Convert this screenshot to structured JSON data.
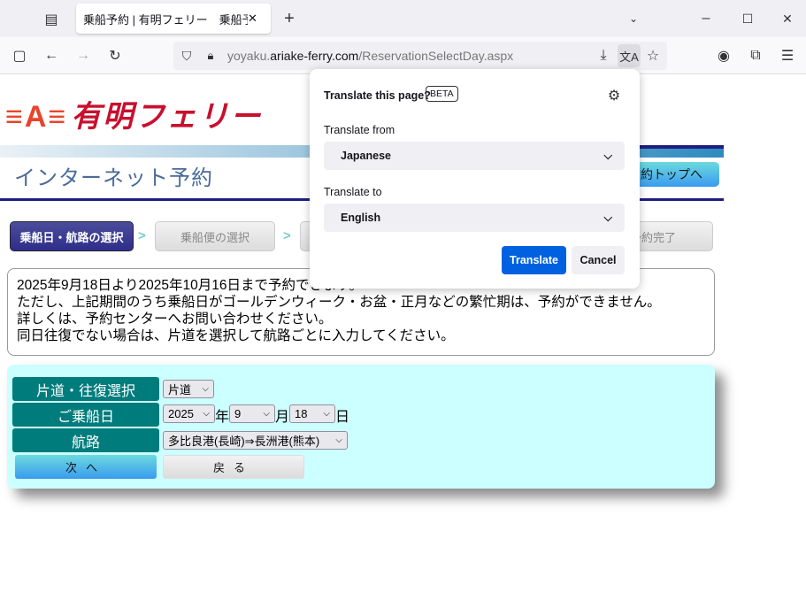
{
  "browser": {
    "tab_title": "乗船予約 | 有明フェリー　乗船予約",
    "url_prefix": "yoyaku.",
    "url_domain": "ariake-ferry.com",
    "url_path": "/ReservationSelectDay.aspx"
  },
  "header": {
    "logo_text": "有明フェリー",
    "subtitle": "インターネット予約",
    "top_button": "予約トップへ"
  },
  "steps": [
    {
      "label": "乗船日・航路の選択",
      "active": true
    },
    {
      "label": "乗船便の選択",
      "active": false
    },
    {
      "label": "",
      "active": false
    },
    {
      "label": "予約完了",
      "active": false
    }
  ],
  "notice": [
    "2025年9月18日より2025年10月16日まで予約できます。",
    "ただし、上記期間のうち乗船日がゴールデンウィーク・お盆・正月などの繁忙期は、予約ができません。",
    "詳しくは、予約センターへお問い合わせください。",
    "同日往復でない場合は、片道を選択して航路ごとに入力してください。"
  ],
  "form": {
    "trip_label": "片道・往復選択",
    "trip_value": "片道",
    "date_label": "ご乗船日",
    "year": "2025",
    "year_suffix": "年",
    "month": "9",
    "month_suffix": "月",
    "day": "18",
    "day_suffix": "日",
    "route_label": "航路",
    "route_value": "多比良港(長崎)⇒長洲港(熊本)",
    "next_button": "次へ",
    "back_button": "戻る"
  },
  "translate_popup": {
    "title": "Translate this page?",
    "badge": "BETA",
    "from_label": "Translate from",
    "from_value": "Japanese",
    "to_label": "Translate to",
    "to_value": "English",
    "translate_button": "Translate",
    "cancel_button": "Cancel",
    "accent": "#0061e0"
  }
}
